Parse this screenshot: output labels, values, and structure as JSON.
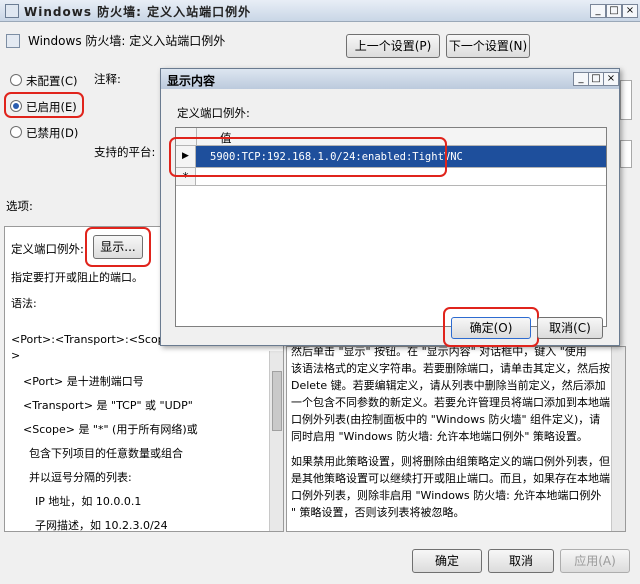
{
  "window": {
    "title": "Windows 防火墙: 定义入站端口例外",
    "controls": [
      "_",
      "□",
      "×"
    ]
  },
  "header": {
    "policy_title": "Windows 防火墙: 定义入站端口例外",
    "prev_button": "上一个设置(P)",
    "next_button": "下一个设置(N)"
  },
  "state": {
    "options": [
      {
        "label": "未配置(C)",
        "selected": false
      },
      {
        "label": "已启用(E)",
        "selected": true
      },
      {
        "label": "已禁用(D)",
        "selected": false
      }
    ],
    "comment_label": "注释:",
    "platform_label": "支持的平台:"
  },
  "options_label": "选项:",
  "options_panel": {
    "exceptions_label": "定义端口例外:",
    "show_button": "显示...",
    "lines": [
      "指定要打开或阻止的端口。",
      "语法:",
      "<Port>:<Transport>:<Scope",
      ">",
      "<Port> 是十进制端口号",
      "<Transport> 是 \"TCP\" 或 \"UDP\"",
      "<Scope> 是 \"*\" (用于所有网络)或",
      "包含下列项目的任意数量或组合",
      "并以逗号分隔的列表:",
      "IP 地址，如 10.0.0.1",
      "子网描述，如 10.2.3.0/24"
    ]
  },
  "help_panel": {
    "lines": [
      "然后单击 \"显示\" 按钮。在 \"显示内容\" 对话框中，键入 \"使用",
      "该语法格式的定义字符串。若要删除端口，请单击其定义，然后按",
      "Delete 键。若要编辑定义，请从列表中删除当前定义，然后添加",
      "一个包含不同参数的新定义。若要允许管理员将端口添加到本地端",
      "口例外列表(由控制面板中的 \"Windows 防火墙\" 组件定义)，请",
      "同时启用 \"Windows 防火墙: 允许本地端口例外\" 策略设置。",
      "",
      "如果禁用此策略设置，则将删除由组策略定义的端口例外列表，但",
      "是其他策略设置可以继续打开或阻止端口。而且，如果存在本地端",
      "口例外列表，则除非启用 \"Windows 防火墙: 允许本地端口例外",
      "\" 策略设置，否则该列表将被忽略。"
    ]
  },
  "footer": {
    "ok": "确定",
    "cancel": "取消",
    "apply": "应用(A)"
  },
  "dialog": {
    "title": "显示内容",
    "controls": [
      "_",
      "□",
      "×"
    ],
    "list_label": "定义端口例外:",
    "column_header": "值",
    "rows": [
      {
        "marker": "▶",
        "value": "5900:TCP:192.168.1.0/24:enabled:TightVNC"
      },
      {
        "marker": "*",
        "value": ""
      }
    ],
    "ok": "确定(O)",
    "cancel": "取消(C)"
  }
}
